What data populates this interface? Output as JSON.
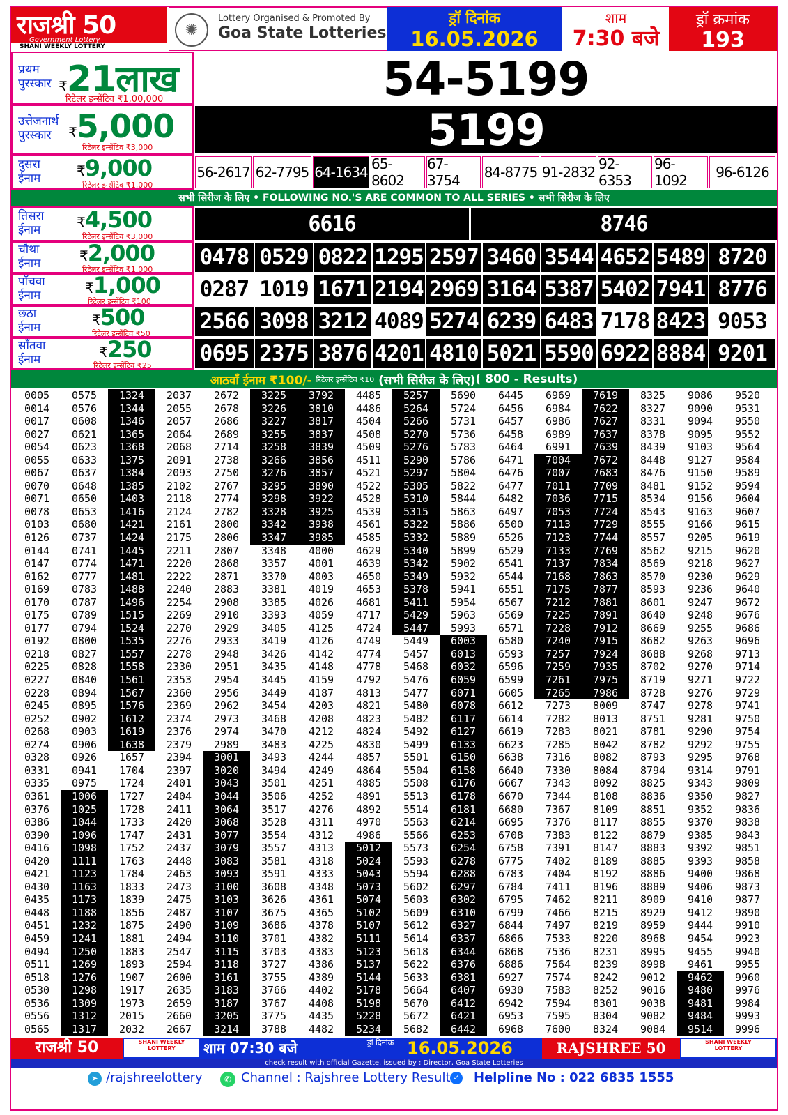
{
  "header": {
    "logo_title": "राजश्री 50",
    "logo_sub": "Government Lottery",
    "logo_shani": "SHANI WEEKLY LOTTERY",
    "organiser_line1": "Lottery Organised & Promoted By",
    "organiser_line2": "Goa State Lotteries",
    "draw_date_label": "ड्रॉ दिनांक",
    "draw_date": "16.05.2026",
    "time_label": "शाम",
    "time": "7:30 बजे",
    "draw_no_label": "ड्रॉ क्रमांक",
    "draw_no": "193"
  },
  "prizes": {
    "first": {
      "name": "प्रथम पुरस्कार",
      "rupee": "₹",
      "amount": "21लाख",
      "retailer": "रिटेलर इन्सेंटिव ₹1,00,000",
      "number": "54-5199"
    },
    "consolation": {
      "name": "उत्तेजनार्थ पुरस्कार",
      "rupee": "₹",
      "amount": "5,000",
      "retailer": "रिटेलर इन्सेंटिव ₹3,000",
      "number": "5199"
    },
    "second": {
      "name": "दुसरा ईनाम",
      "rupee": "₹",
      "amount": "9,000",
      "retailer": "रिटेलर इन्सेंटिव ₹1,000",
      "numbers": [
        "56-2617",
        "62-7795",
        "64-1634",
        "65-8602",
        "67-3754",
        "84-8775",
        "91-2832",
        "92-6353",
        "96-1092",
        "96-6126"
      ]
    },
    "common_note": "सभी सिरीज के लिए  •  FOLLOWING NO.'S ARE COMMON TO ALL SERIES • सभी सिरीज के लिए",
    "third": {
      "name": "तिसरा ईनाम",
      "rupee": "₹",
      "amount": "4,500",
      "retailer": "रिटेलर इन्सेंटिव ₹3,000",
      "numbers": [
        "6616",
        "8746"
      ]
    },
    "fourth": {
      "name": "चौथा ईनाम",
      "rupee": "₹",
      "amount": "2,000",
      "retailer": "रिटेलर इन्सेंटिव ₹1,000",
      "numbers": [
        "0478",
        "0529",
        "0822",
        "1295",
        "2597",
        "3460",
        "3544",
        "4652",
        "5489",
        "8720"
      ]
    },
    "fifth": {
      "name": "पाँचवा ईनाम",
      "rupee": "₹",
      "amount": "1,000",
      "retailer": "रिटेलर इन्सेंटिव ₹100",
      "numbers": [
        "0287",
        "1019",
        "1671",
        "2194",
        "2969",
        "3164",
        "5387",
        "5402",
        "7941",
        "8776"
      ]
    },
    "sixth": {
      "name": "छठा ईनाम",
      "rupee": "₹",
      "amount": "500",
      "retailer": "रिटेलर इन्सेंटिव ₹50",
      "numbers": [
        "2566",
        "3098",
        "3212",
        "4089",
        "5274",
        "6239",
        "6483",
        "7178",
        "8423",
        "9053"
      ]
    },
    "seventh": {
      "name": "साँतवा ईनाम",
      "rupee": "₹",
      "amount": "250",
      "retailer": "रिटेलर इन्सेंटिव ₹25",
      "numbers": [
        "0695",
        "2375",
        "3876",
        "4201",
        "4810",
        "5021",
        "5590",
        "6922",
        "8884",
        "9201"
      ]
    },
    "eighth": {
      "title": "आठवाँ ईनाम ₹100/-",
      "retailer": "रिटेलर इन्सेंटिव ₹10",
      "note": "(सभी सिरीज के लिए)",
      "results": "( 800 - Results)"
    }
  },
  "eighth_columns": [
    [
      "0005",
      "0014",
      "0017",
      "0027",
      "0054",
      "0055",
      "0067",
      "0070",
      "0071",
      "0078",
      "0103",
      "0126",
      "0144",
      "0147",
      "0162",
      "0169",
      "0170",
      "0175",
      "0177",
      "0192",
      "0218",
      "0225",
      "0227",
      "0228",
      "0245",
      "0252",
      "0268",
      "0274",
      "0328",
      "0331",
      "0335",
      "0361",
      "0376",
      "0386",
      "0390",
      "0416",
      "0420",
      "0421",
      "0430",
      "0435",
      "0448",
      "0451",
      "0459",
      "0494",
      "0511",
      "0518",
      "0530",
      "0536",
      "0556",
      "0565"
    ],
    [
      "0575",
      "0576",
      "0608",
      "0621",
      "0623",
      "0633",
      "0637",
      "0648",
      "0650",
      "0653",
      "0680",
      "0737",
      "0741",
      "0774",
      "0777",
      "0783",
      "0787",
      "0789",
      "0794",
      "0800",
      "0827",
      "0828",
      "0840",
      "0894",
      "0895",
      "0902",
      "0903",
      "0906",
      "0926",
      "0941",
      "0975",
      "1006",
      "1025",
      "1044",
      "1096",
      "1098",
      "1111",
      "1123",
      "1163",
      "1173",
      "1188",
      "1232",
      "1241",
      "1250",
      "1269",
      "1276",
      "1298",
      "1309",
      "1312",
      "1317"
    ],
    [
      "1324",
      "1344",
      "1346",
      "1365",
      "1368",
      "1375",
      "1384",
      "1385",
      "1403",
      "1416",
      "1421",
      "1424",
      "1445",
      "1471",
      "1481",
      "1488",
      "1496",
      "1515",
      "1524",
      "1535",
      "1557",
      "1558",
      "1561",
      "1567",
      "1576",
      "1612",
      "1619",
      "1638",
      "1657",
      "1704",
      "1724",
      "1727",
      "1728",
      "1733",
      "1747",
      "1752",
      "1763",
      "1784",
      "1833",
      "1839",
      "1856",
      "1875",
      "1881",
      "1883",
      "1893",
      "1907",
      "1917",
      "1973",
      "2015",
      "2032"
    ],
    [
      "2037",
      "2055",
      "2057",
      "2064",
      "2068",
      "2091",
      "2093",
      "2102",
      "2118",
      "2124",
      "2161",
      "2175",
      "2211",
      "2220",
      "2222",
      "2240",
      "2254",
      "2269",
      "2270",
      "2276",
      "2278",
      "2330",
      "2353",
      "2360",
      "2369",
      "2374",
      "2376",
      "2379",
      "2394",
      "2397",
      "2401",
      "2404",
      "2411",
      "2420",
      "2431",
      "2437",
      "2448",
      "2463",
      "2473",
      "2475",
      "2487",
      "2490",
      "2494",
      "2547",
      "2594",
      "2600",
      "2635",
      "2659",
      "2660",
      "2667"
    ],
    [
      "2672",
      "2678",
      "2686",
      "2689",
      "2714",
      "2738",
      "2750",
      "2767",
      "2774",
      "2782",
      "2800",
      "2806",
      "2807",
      "2868",
      "2871",
      "2883",
      "2908",
      "2910",
      "2929",
      "2933",
      "2948",
      "2951",
      "2954",
      "2956",
      "2962",
      "2973",
      "2974",
      "2989",
      "3001",
      "3020",
      "3043",
      "3044",
      "3064",
      "3068",
      "3077",
      "3079",
      "3083",
      "3093",
      "3100",
      "3103",
      "3107",
      "3109",
      "3110",
      "3115",
      "3118",
      "3161",
      "3183",
      "3187",
      "3205",
      "3214"
    ],
    [
      "3225",
      "3226",
      "3227",
      "3255",
      "3258",
      "3266",
      "3276",
      "3295",
      "3298",
      "3328",
      "3342",
      "3347",
      "3348",
      "3357",
      "3370",
      "3381",
      "3385",
      "3393",
      "3405",
      "3419",
      "3426",
      "3435",
      "3445",
      "3449",
      "3454",
      "3468",
      "3470",
      "3483",
      "3493",
      "3494",
      "3501",
      "3506",
      "3517",
      "3528",
      "3554",
      "3557",
      "3581",
      "3591",
      "3608",
      "3626",
      "3675",
      "3686",
      "3701",
      "3703",
      "3727",
      "3755",
      "3766",
      "3767",
      "3775",
      "3788"
    ],
    [
      "3792",
      "3810",
      "3817",
      "3837",
      "3839",
      "3856",
      "3857",
      "3890",
      "3922",
      "3925",
      "3938",
      "3985",
      "4000",
      "4001",
      "4003",
      "4019",
      "4026",
      "4059",
      "4125",
      "4126",
      "4142",
      "4148",
      "4159",
      "4187",
      "4203",
      "4208",
      "4212",
      "4225",
      "4244",
      "4249",
      "4251",
      "4252",
      "4276",
      "4311",
      "4312",
      "4313",
      "4318",
      "4333",
      "4348",
      "4361",
      "4365",
      "4378",
      "4382",
      "4383",
      "4386",
      "4389",
      "4402",
      "4408",
      "4435",
      "4482"
    ],
    [
      "4485",
      "4486",
      "4504",
      "4508",
      "4509",
      "4511",
      "4521",
      "4522",
      "4528",
      "4539",
      "4561",
      "4585",
      "4629",
      "4639",
      "4650",
      "4653",
      "4681",
      "4717",
      "4724",
      "4749",
      "4774",
      "4778",
      "4792",
      "4813",
      "4821",
      "4823",
      "4824",
      "4830",
      "4857",
      "4864",
      "4885",
      "4891",
      "4892",
      "4970",
      "4986",
      "5012",
      "5024",
      "5043",
      "5073",
      "5074",
      "5102",
      "5107",
      "5111",
      "5123",
      "5137",
      "5144",
      "5178",
      "5198",
      "5228",
      "5234"
    ],
    [
      "5257",
      "5264",
      "5266",
      "5270",
      "5276",
      "5290",
      "5297",
      "5305",
      "5310",
      "5315",
      "5322",
      "5332",
      "5340",
      "5342",
      "5349",
      "5378",
      "5411",
      "5429",
      "5447",
      "5449",
      "5457",
      "5468",
      "5476",
      "5477",
      "5480",
      "5482",
      "5492",
      "5499",
      "5501",
      "5504",
      "5508",
      "5513",
      "5514",
      "5563",
      "5566",
      "5573",
      "5593",
      "5594",
      "5602",
      "5603",
      "5609",
      "5612",
      "5614",
      "5618",
      "5622",
      "5633",
      "5664",
      "5670",
      "5672",
      "5682"
    ],
    [
      "5690",
      "5724",
      "5731",
      "5736",
      "5783",
      "5786",
      "5804",
      "5822",
      "5844",
      "5863",
      "5886",
      "5889",
      "5899",
      "5902",
      "5932",
      "5941",
      "5954",
      "5963",
      "5993",
      "6003",
      "6013",
      "6032",
      "6059",
      "6071",
      "6078",
      "6117",
      "6127",
      "6133",
      "6150",
      "6158",
      "6176",
      "6178",
      "6181",
      "6214",
      "6253",
      "6254",
      "6278",
      "6288",
      "6297",
      "6302",
      "6310",
      "6327",
      "6337",
      "6344",
      "6376",
      "6381",
      "6407",
      "6412",
      "6421",
      "6442"
    ],
    [
      "6445",
      "6456",
      "6457",
      "6458",
      "6464",
      "6471",
      "6476",
      "6477",
      "6482",
      "6497",
      "6500",
      "6526",
      "6529",
      "6541",
      "6544",
      "6551",
      "6567",
      "6569",
      "6571",
      "6580",
      "6593",
      "6596",
      "6599",
      "6605",
      "6612",
      "6614",
      "6619",
      "6623",
      "6638",
      "6640",
      "6667",
      "6670",
      "6680",
      "6695",
      "6708",
      "6758",
      "6775",
      "6783",
      "6784",
      "6795",
      "6799",
      "6844",
      "6866",
      "6868",
      "6886",
      "6927",
      "6930",
      "6942",
      "6953",
      "6968"
    ],
    [
      "6969",
      "6984",
      "6986",
      "6989",
      "6991",
      "7004",
      "7007",
      "7011",
      "7036",
      "7053",
      "7113",
      "7123",
      "7133",
      "7137",
      "7168",
      "7175",
      "7212",
      "7225",
      "7228",
      "7240",
      "7257",
      "7259",
      "7261",
      "7265",
      "7273",
      "7282",
      "7283",
      "7285",
      "7316",
      "7330",
      "7343",
      "7344",
      "7367",
      "7376",
      "7383",
      "7391",
      "7402",
      "7404",
      "7411",
      "7462",
      "7466",
      "7497",
      "7533",
      "7536",
      "7564",
      "7574",
      "7583",
      "7594",
      "7595",
      "7600"
    ],
    [
      "7619",
      "7622",
      "7627",
      "7637",
      "7639",
      "7672",
      "7683",
      "7709",
      "7715",
      "7724",
      "7729",
      "7744",
      "7769",
      "7834",
      "7863",
      "7877",
      "7881",
      "7891",
      "7912",
      "7915",
      "7924",
      "7935",
      "7975",
      "7986",
      "8009",
      "8013",
      "8021",
      "8042",
      "8082",
      "8084",
      "8092",
      "8108",
      "8109",
      "8117",
      "8122",
      "8147",
      "8189",
      "8192",
      "8196",
      "8211",
      "8215",
      "8219",
      "8220",
      "8231",
      "8239",
      "8242",
      "8252",
      "8301",
      "8304",
      "8324"
    ],
    [
      "8325",
      "8327",
      "8331",
      "8378",
      "8439",
      "8448",
      "8476",
      "8481",
      "8534",
      "8543",
      "8555",
      "8557",
      "8562",
      "8569",
      "8570",
      "8593",
      "8601",
      "8640",
      "8669",
      "8682",
      "8688",
      "8702",
      "8719",
      "8728",
      "8747",
      "8751",
      "8781",
      "8782",
      "8793",
      "8794",
      "8825",
      "8836",
      "8851",
      "8855",
      "8879",
      "8883",
      "8885",
      "8886",
      "8889",
      "8909",
      "8929",
      "8959",
      "8968",
      "8995",
      "8998",
      "9012",
      "9016",
      "9038",
      "9082",
      "9084"
    ],
    [
      "9086",
      "9090",
      "9094",
      "9095",
      "9103",
      "9127",
      "9150",
      "9152",
      "9156",
      "9163",
      "9166",
      "9205",
      "9215",
      "9218",
      "9230",
      "9236",
      "9247",
      "9248",
      "9255",
      "9263",
      "9268",
      "9270",
      "9271",
      "9276",
      "9278",
      "9281",
      "9290",
      "9292",
      "9295",
      "9314",
      "9343",
      "9350",
      "9352",
      "9370",
      "9385",
      "9392",
      "9393",
      "9400",
      "9406",
      "9410",
      "9412",
      "9444",
      "9454",
      "9455",
      "9461",
      "9462",
      "9480",
      "9481",
      "9484",
      "9514"
    ],
    [
      "9520",
      "9531",
      "9550",
      "9552",
      "9564",
      "9584",
      "9589",
      "9594",
      "9604",
      "9607",
      "9615",
      "9619",
      "9620",
      "9627",
      "9629",
      "9640",
      "9672",
      "9676",
      "9686",
      "9696",
      "9713",
      "9714",
      "9722",
      "9729",
      "9741",
      "9750",
      "9754",
      "9755",
      "9768",
      "9791",
      "9809",
      "9827",
      "9836",
      "9838",
      "9843",
      "9851",
      "9858",
      "9868",
      "9873",
      "9877",
      "9890",
      "9910",
      "9923",
      "9940",
      "9955",
      "9960",
      "9976",
      "9984",
      "9993",
      "9996"
    ]
  ],
  "footer": {
    "logo": "राजश्री 50",
    "shani_small": "SHANI WEEKLY LOTTERY",
    "time": "शाम 07:30 बजे",
    "date_label": "ड्रॉ दिनांक",
    "date": "16.05.2026",
    "brand": "RAJSHREE 50",
    "shani_small_2": "SHANI WEEKLY LOTTERY",
    "notice": "check result with official Gazette. issued by : Director, Goa State Lotteries",
    "telegram": "/rajshreelottery",
    "channel": "Channel : Rajshree Lottery Result",
    "helpline": "Helpline No : 022 6835 1555"
  },
  "colors": {
    "pink": "#e4007c",
    "red": "#e30613",
    "blue": "#0d2fd6",
    "green": "#00873c",
    "yellow": "#ffd800"
  }
}
